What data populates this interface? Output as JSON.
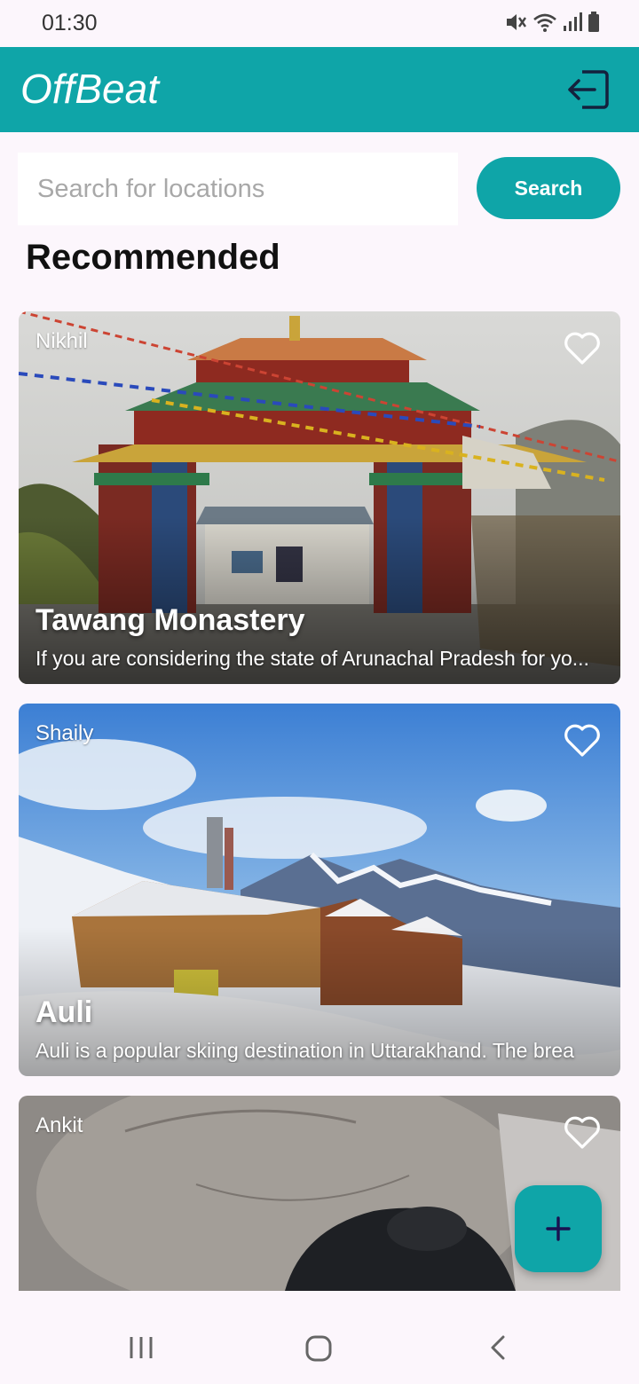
{
  "status_bar": {
    "time": "01:30",
    "icons": [
      "mute-icon",
      "wifi-icon",
      "signal-icon",
      "battery-icon"
    ]
  },
  "app_bar": {
    "title": "OffBeat",
    "action_icon": "logout-icon"
  },
  "search": {
    "placeholder": "Search for locations",
    "value": "",
    "button_label": "Search"
  },
  "section": {
    "title": "Recommended"
  },
  "cards": [
    {
      "author": "Nikhil",
      "title": "Tawang Monastery",
      "description": "If you are considering the state of Arunachal Pradesh for yo...",
      "favorite_icon": "heart-outline-icon"
    },
    {
      "author": "Shaily",
      "title": "Auli",
      "description": "Auli is a popular skiing destination in Uttarakhand. The brea",
      "favorite_icon": "heart-outline-icon"
    },
    {
      "author": "Ankit",
      "title": "",
      "description": "",
      "favorite_icon": "heart-outline-icon"
    }
  ],
  "fab": {
    "icon": "plus-icon"
  },
  "nav_bar": {
    "icons": [
      "recent-apps-icon",
      "home-icon",
      "back-icon"
    ]
  },
  "colors": {
    "primary": "#0FA5A8",
    "background": "#FCF6FC",
    "fab_icon": "#1A1250"
  }
}
